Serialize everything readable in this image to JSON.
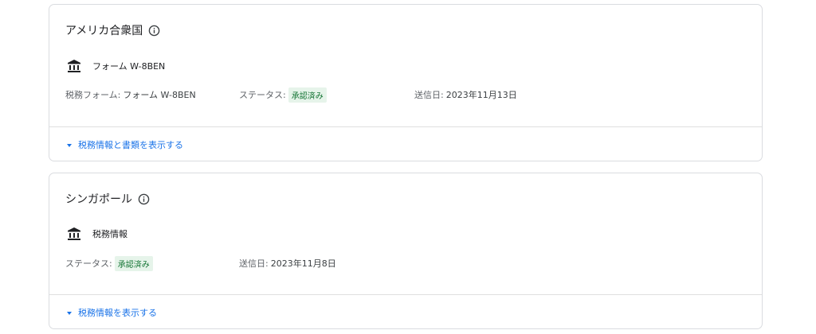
{
  "cards": [
    {
      "title": "アメリカ合衆国",
      "form_name": "フォーム W-8BEN",
      "tax_form_label": "税務フォーム:",
      "tax_form_value": "フォーム W-8BEN",
      "status_label": "ステータス:",
      "status_value": "承認済み",
      "sent_label": "送信日:",
      "sent_value": "2023年11月13日",
      "expander_label": "税務情報と書類を表示する"
    },
    {
      "title": "シンガポール",
      "form_name": "税務情報",
      "status_label": "ステータス:",
      "status_value": "承認済み",
      "sent_label": "送信日:",
      "sent_value": "2023年11月8日",
      "expander_label": "税務情報を表示する"
    }
  ],
  "colors": {
    "link": "#1a73e8",
    "badge_bg": "#e6f4ea",
    "badge_text": "#137333",
    "border": "#dadce0"
  },
  "icons": {
    "info": "info-icon",
    "bank": "bank-icon",
    "expand": "caret-down-icon"
  }
}
